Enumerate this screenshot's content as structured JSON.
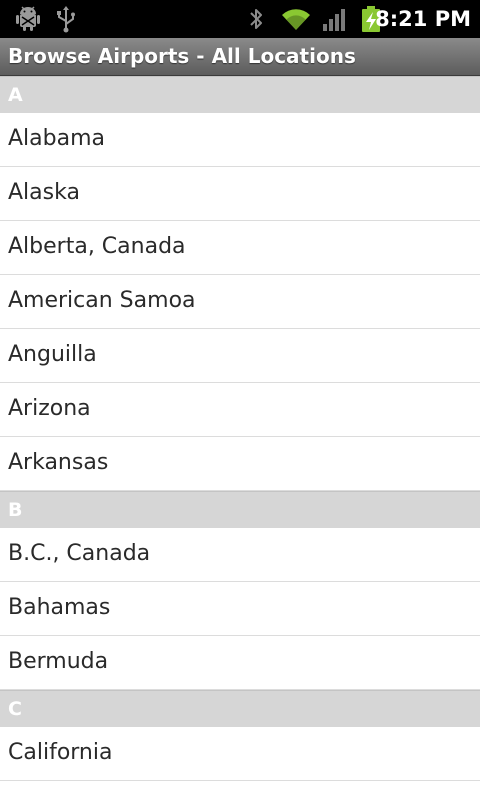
{
  "status_bar": {
    "time": "8:21 PM",
    "icons": [
      "android-debug-icon",
      "usb-icon",
      "bluetooth-icon",
      "wifi-icon",
      "signal-icon",
      "battery-charging-icon"
    ],
    "colors": {
      "wifi": "#8ac832",
      "battery": "#8ac832"
    }
  },
  "title_bar": {
    "title": "Browse Airports - All Locations"
  },
  "sections": [
    {
      "letter": "A",
      "items": [
        "Alabama",
        "Alaska",
        "Alberta, Canada",
        "American Samoa",
        "Anguilla",
        "Arizona",
        "Arkansas"
      ]
    },
    {
      "letter": "B",
      "items": [
        "B.C., Canada",
        "Bahamas",
        "Bermuda"
      ]
    },
    {
      "letter": "C",
      "items": [
        "California"
      ]
    }
  ]
}
